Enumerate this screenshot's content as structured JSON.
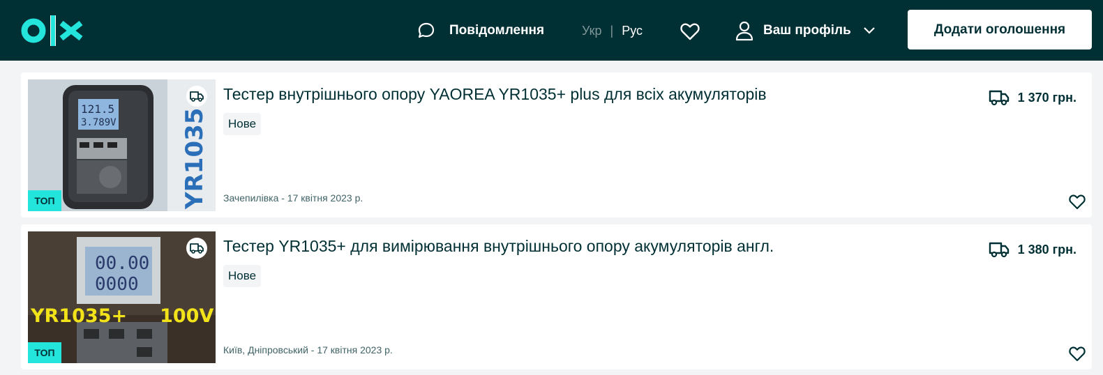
{
  "header": {
    "logo_text": "OLX",
    "messages_label": "Повідомлення",
    "lang_ukr": "Укр",
    "lang_sep": "|",
    "lang_rus": "Рус",
    "profile_label": "Ваш профіль",
    "add_button": "Додати оголошення"
  },
  "listings": [
    {
      "title": "Тестер внутрішнього опору YAOREA YR1035+ plus для всіх акумуляторів",
      "condition": "Нове",
      "location_date": "Зачепилівка - 17 квітня 2023 р.",
      "price": "1 370 грн.",
      "badge": "ТОП",
      "photo_text": "YR1035"
    },
    {
      "title": "Тестер YR1035+ для вимірювання внутрішнього опору акумуляторів англ.",
      "condition": "Нове",
      "location_date": "Київ, Дніпровський - 17 квітня 2023 р.",
      "price": "1 380 грн.",
      "badge": "ТОП",
      "photo_text": "YR1035+     100V"
    }
  ],
  "colors": {
    "header_bg": "#002f34",
    "accent": "#23e5db",
    "text": "#002f34"
  }
}
